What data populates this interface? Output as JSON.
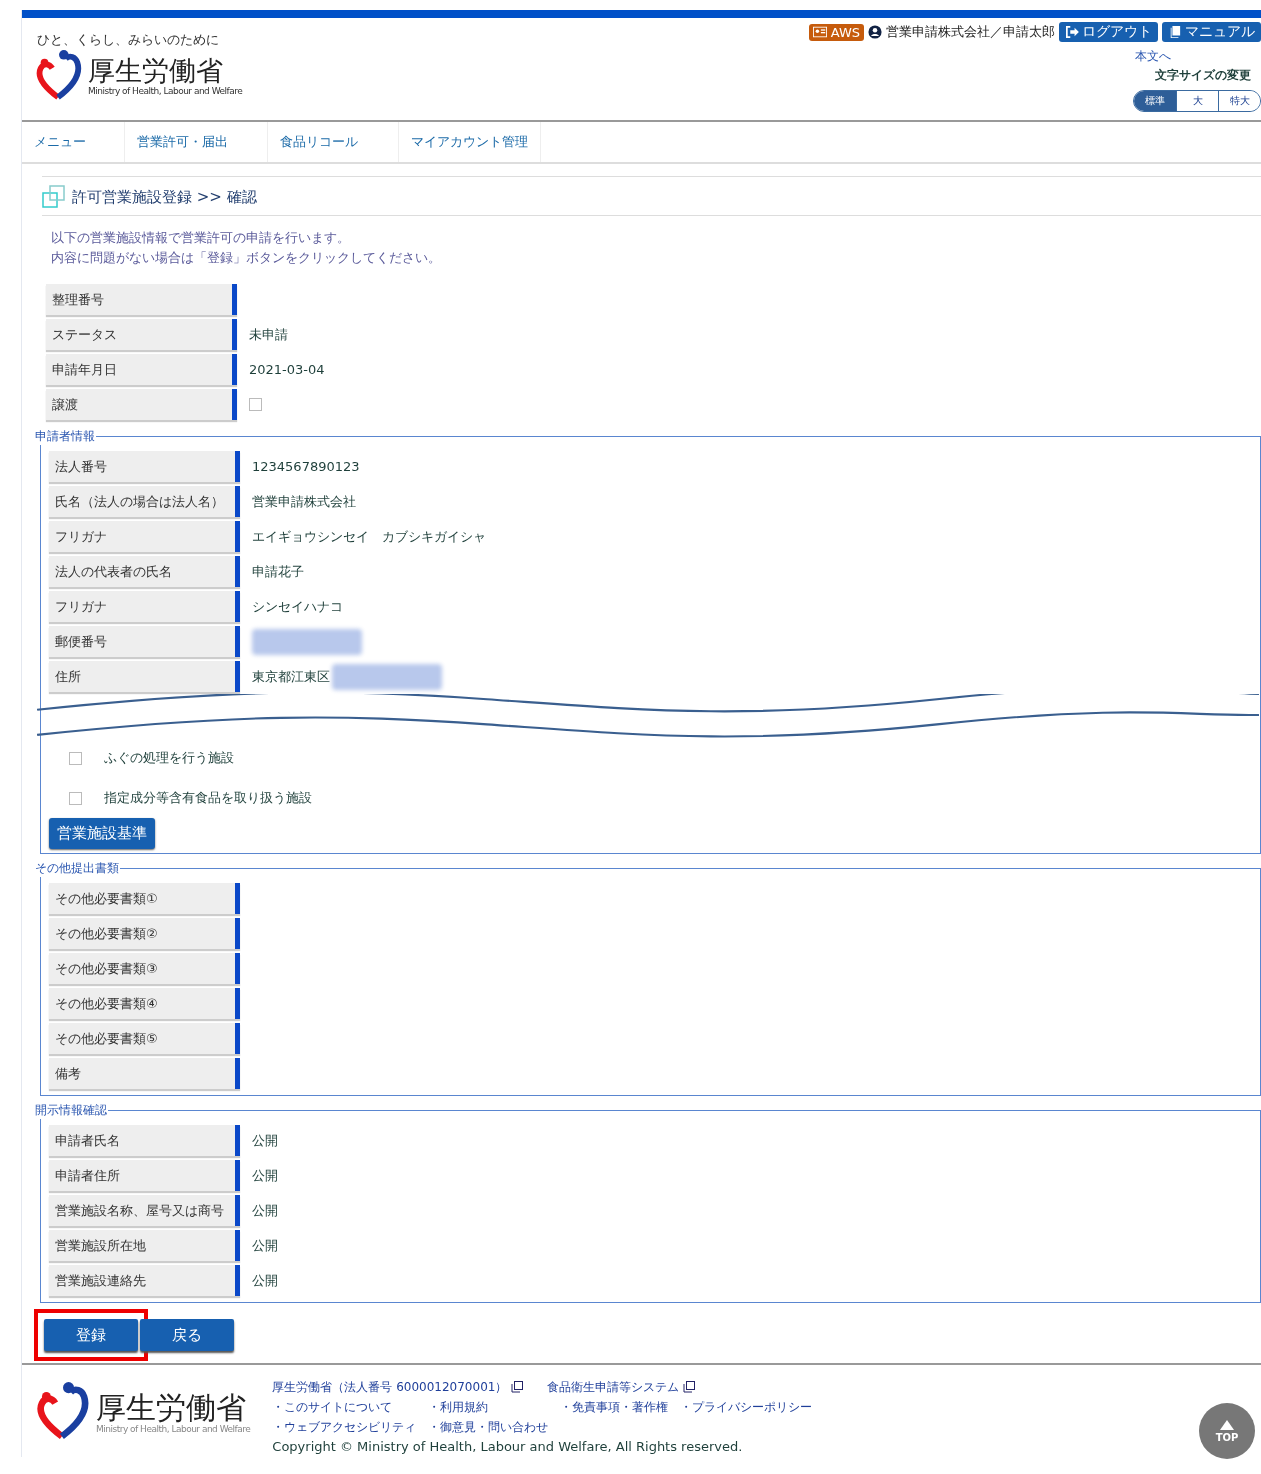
{
  "header": {
    "tagline": "ひと、くらし、みらいのために",
    "logo_name": "厚生労働省",
    "logo_english": "Ministry of Health, Labour and Welfare",
    "aws_badge": "AWS",
    "user": "営業申請株式会社／申請太郎",
    "logout": "ログアウト",
    "manual": "マニュアル",
    "skip_link": "本文へ",
    "font_size_label": "文字サイズの変更",
    "font_sizes": [
      {
        "label": "標準",
        "selected": true
      },
      {
        "label": "大",
        "selected": false
      },
      {
        "label": "特大",
        "selected": false
      }
    ]
  },
  "nav": [
    "メニュー",
    "営業許可・届出",
    "食品リコール",
    "マイアカウント管理"
  ],
  "page_title": "許可営業施設登録 >> 確認",
  "instructions": [
    "以下の営業施設情報で営業許可の申請を行います。",
    "内容に問題がない場合は「登録」ボタンをクリックしてください。"
  ],
  "fields": [
    {
      "label": "整理番号",
      "kind": "text"
    },
    {
      "label": "ステータス",
      "kind": "text",
      "value": "未申請"
    },
    {
      "label": "申請年月日",
      "kind": "text",
      "value": "2021-03-04"
    },
    {
      "label": "譲渡",
      "kind": "checkbox",
      "checked": false
    }
  ],
  "sections": [
    {
      "legend": "申請者情報",
      "rows": [
        {
          "label": "法人番号",
          "kind": "text",
          "value": "1234567890123"
        },
        {
          "label": "氏名（法人の場合は法人名）",
          "kind": "text",
          "value": "営業申請株式会社"
        },
        {
          "label": "フリガナ",
          "kind": "text",
          "value": "エイギョウシンセイ　カブシキガイシャ"
        },
        {
          "label": "法人の代表者の氏名",
          "kind": "text",
          "value": "申請花子"
        },
        {
          "label": "フリガナ",
          "kind": "text",
          "value": "シンセイハナコ"
        },
        {
          "label": "郵便番号",
          "kind": "redacted"
        },
        {
          "label": "住所",
          "kind": "redacted",
          "value": "東京都江東区"
        }
      ],
      "cut": true,
      "options": [
        {
          "label": "ふぐの処理を行う施設",
          "checked": false
        },
        {
          "label": "指定成分等含有食品を取り扱う施設",
          "checked": false
        }
      ],
      "button": "営業施設基準"
    },
    {
      "legend": "その他提出書類",
      "rows": [
        {
          "label": "その他必要書類①",
          "kind": "text"
        },
        {
          "label": "その他必要書類②",
          "kind": "text"
        },
        {
          "label": "その他必要書類③",
          "kind": "text"
        },
        {
          "label": "その他必要書類④",
          "kind": "text"
        },
        {
          "label": "その他必要書類⑤",
          "kind": "text"
        },
        {
          "label": "備考",
          "kind": "text"
        }
      ],
      "cut": false
    },
    {
      "legend": "開示情報確認",
      "rows": [
        {
          "label": "申請者氏名",
          "kind": "text",
          "value": "公開"
        },
        {
          "label": "申請者住所",
          "kind": "text",
          "value": "公開"
        },
        {
          "label": "営業施設名称、屋号又は商号",
          "kind": "text",
          "value": "公開"
        },
        {
          "label": "営業施設所在地",
          "kind": "text",
          "value": "公開"
        },
        {
          "label": "営業施設連絡先",
          "kind": "text",
          "value": "公開"
        }
      ],
      "cut": false
    }
  ],
  "actions": [
    {
      "label": "登録",
      "highlighted": true
    },
    {
      "label": "戻る",
      "highlighted": false
    }
  ],
  "footer": {
    "logo_name": "厚生労働省",
    "logo_english": "Ministry of Health, Labour and Welfare",
    "links_top": [
      "厚生労働省（法人番号 6000012070001）",
      "食品衛生申請等システム"
    ],
    "links": [
      "・このサイトについて",
      "・利用規約",
      "・免責事項・著作権",
      "・プライバシーポリシー",
      "・ウェブアクセシビリティ",
      "・御意見・問い合わせ"
    ],
    "copyright": "Copyright © Ministry of Health, Labour and Welfare, All Rights reserved.",
    "top_button": "TOP"
  }
}
